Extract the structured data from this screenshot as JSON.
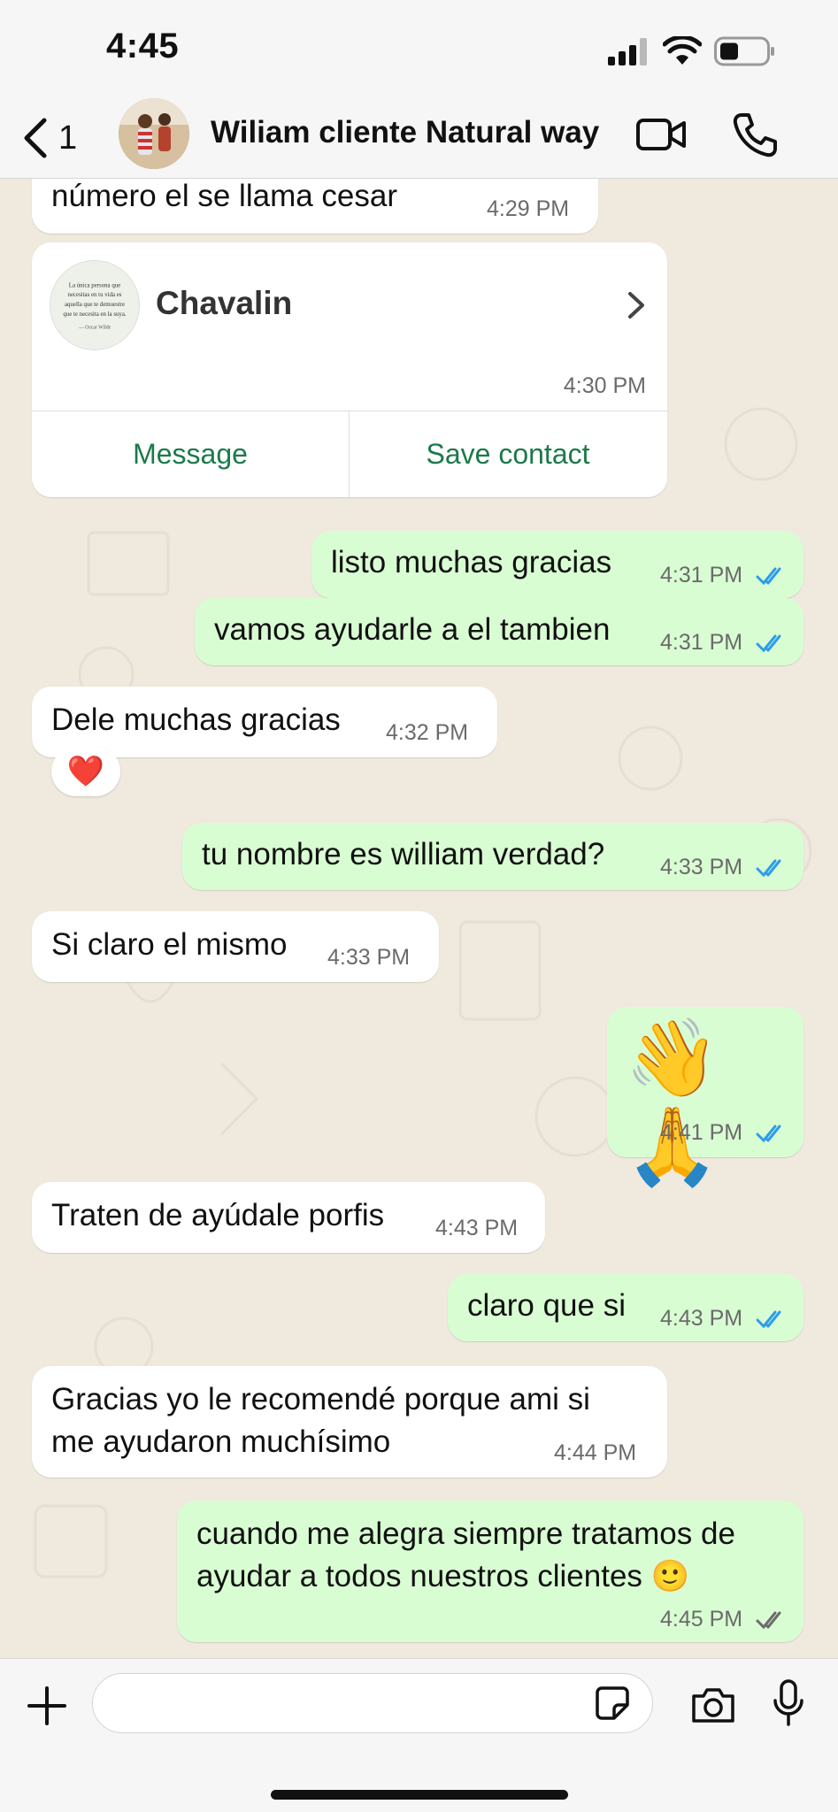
{
  "status_bar": {
    "time": "4:45"
  },
  "header": {
    "back_count": "1",
    "contact_name": "Wiliam cliente Natural way"
  },
  "colors": {
    "outgoing_bubble": "#d9fdd3",
    "incoming_bubble": "#ffffff",
    "read_ticks": "#2f9ce9",
    "accent": "#1c7a4a"
  },
  "messages": [
    {
      "dir": "in",
      "text": "número el se llama cesar",
      "time": "4:29 PM"
    },
    {
      "dir": "in",
      "type": "contact_card",
      "card_name": "Chavalin",
      "time": "4:30 PM",
      "avatar_text": [
        "La única persona que",
        "necesitas en tu vida es",
        "aquella que te demuestre",
        "que te necesita en la suya.",
        "— Oscar Wilde"
      ],
      "actions": [
        "Message",
        "Save contact"
      ]
    },
    {
      "dir": "out",
      "text": "listo muchas gracias",
      "time": "4:31 PM",
      "status": "read"
    },
    {
      "dir": "out",
      "text": "vamos ayudarle a el tambien",
      "time": "4:31 PM",
      "status": "read"
    },
    {
      "dir": "in",
      "text": "Dele muchas gracias",
      "time": "4:32 PM",
      "reaction": "❤️"
    },
    {
      "dir": "out",
      "text": "tu nombre es william verdad?",
      "time": "4:33 PM",
      "status": "read"
    },
    {
      "dir": "in",
      "text": "Si claro el mismo",
      "time": "4:33 PM"
    },
    {
      "dir": "out",
      "text": "👋🙏",
      "time": "4:41 PM",
      "status": "read"
    },
    {
      "dir": "in",
      "text": "Traten de ayúdale porfis",
      "time": "4:43 PM"
    },
    {
      "dir": "out",
      "text": "claro que si",
      "time": "4:43 PM",
      "status": "read"
    },
    {
      "dir": "in",
      "lines": [
        "Gracias  yo le recomendé porque ami si",
        "me ayudaron muchísimo"
      ],
      "time": "4:44 PM"
    },
    {
      "dir": "out",
      "lines": [
        "cuando me alegra siempre tratamos de",
        "ayudar a todos nuestros clientes 🙂"
      ],
      "time": "4:45 PM",
      "status": "delivered"
    }
  ],
  "composer": {
    "value": ""
  },
  "icons": [
    "back-chevron-icon",
    "video-call-icon",
    "phone-icon",
    "plus-icon",
    "sticker-icon",
    "camera-icon",
    "microphone-icon",
    "signal-icon",
    "wifi-icon",
    "battery-icon",
    "double-check-icon",
    "chevron-right-icon"
  ]
}
